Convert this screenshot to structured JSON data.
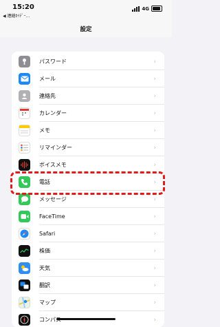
{
  "status": {
    "time": "15:20",
    "back_app": "◀ 連絡ｶｲﾃﾞｰ…",
    "network": "4G"
  },
  "nav": {
    "title": "設定"
  },
  "settings": [
    {
      "label": "パスワード",
      "icon": "key-icon",
      "color": "#8e8e93"
    },
    {
      "label": "メール",
      "icon": "mail-icon",
      "color": "#1e88f5"
    },
    {
      "label": "連絡先",
      "icon": "contacts-icon",
      "color": "#b0b0b5"
    },
    {
      "label": "カレンダー",
      "icon": "calendar-icon",
      "color": "#ffffff"
    },
    {
      "label": "メモ",
      "icon": "notes-icon",
      "color": "#ffcc00"
    },
    {
      "label": "リマインダー",
      "icon": "reminders-icon",
      "color": "#ffffff"
    },
    {
      "label": "ボイスメモ",
      "icon": "voice-memo-icon",
      "color": "#111111"
    },
    {
      "label": "電話",
      "icon": "phone-icon",
      "color": "#34c759"
    },
    {
      "label": "メッセージ",
      "icon": "messages-icon",
      "color": "#34c759"
    },
    {
      "label": "FaceTime",
      "icon": "facetime-icon",
      "color": "#34c759"
    },
    {
      "label": "Safari",
      "icon": "safari-icon",
      "color": "#1e88f5"
    },
    {
      "label": "株価",
      "icon": "stocks-icon",
      "color": "#111111"
    },
    {
      "label": "天気",
      "icon": "weather-icon",
      "color": "#2f8ef0"
    },
    {
      "label": "翻訳",
      "icon": "translate-icon",
      "color": "#111111"
    },
    {
      "label": "マップ",
      "icon": "maps-icon",
      "color": "#ffffff"
    },
    {
      "label": "コンパス",
      "icon": "compass-icon",
      "color": "#111111"
    }
  ],
  "highlight_color": "#e11a1a"
}
